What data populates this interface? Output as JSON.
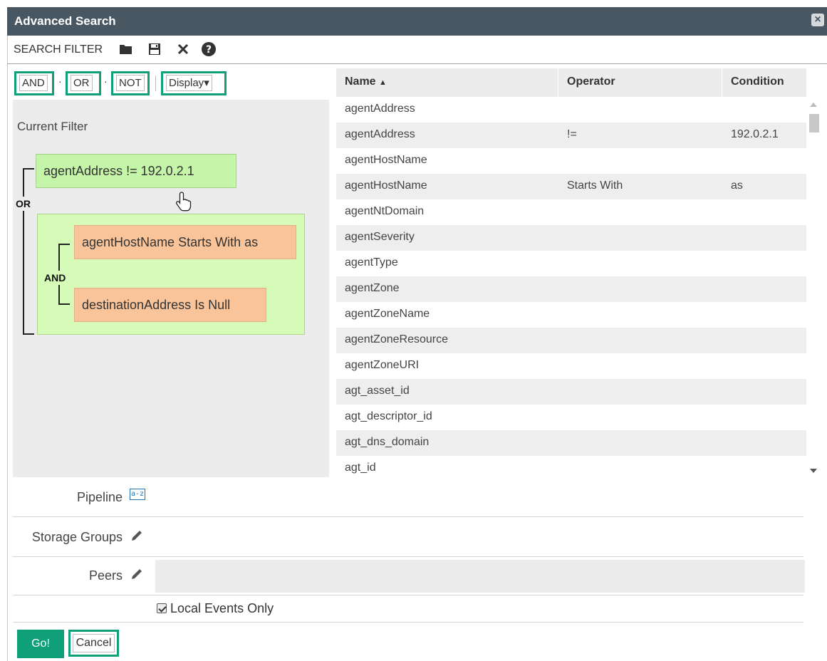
{
  "dialog": {
    "title": "Advanced Search",
    "close_icon": "close-icon"
  },
  "toolbar": {
    "label": "SEARCH FILTER",
    "icons": [
      "folder-open-icon",
      "save-icon",
      "clear-icon",
      "help-icon"
    ]
  },
  "operators": {
    "and": "AND",
    "or": "OR",
    "not": "NOT",
    "separator": "·",
    "display": "Display",
    "display_caret": "▾"
  },
  "filter": {
    "heading": "Current Filter",
    "root_operator": "OR",
    "group_operator": "AND",
    "nodes": {
      "n1": "agentAddress != 192.0.2.1",
      "n2": "agentHostName Starts With as",
      "n3": "destinationAddress Is Null"
    }
  },
  "table": {
    "columns": {
      "name": "Name",
      "operator": "Operator",
      "condition": "Condition"
    },
    "sort_indicator": "▲",
    "rows": [
      {
        "name": "agentAddress",
        "operator": "",
        "condition": ""
      },
      {
        "name": "agentAddress",
        "operator": "!=",
        "condition": "192.0.2.1"
      },
      {
        "name": "agentHostName",
        "operator": "",
        "condition": ""
      },
      {
        "name": "agentHostName",
        "operator": "Starts With",
        "condition": "as"
      },
      {
        "name": "agentNtDomain",
        "operator": "",
        "condition": ""
      },
      {
        "name": "agentSeverity",
        "operator": "",
        "condition": ""
      },
      {
        "name": "agentType",
        "operator": "",
        "condition": ""
      },
      {
        "name": "agentZone",
        "operator": "",
        "condition": ""
      },
      {
        "name": "agentZoneName",
        "operator": "",
        "condition": ""
      },
      {
        "name": "agentZoneResource",
        "operator": "",
        "condition": ""
      },
      {
        "name": "agentZoneURI",
        "operator": "",
        "condition": ""
      },
      {
        "name": "agt_asset_id",
        "operator": "",
        "condition": ""
      },
      {
        "name": "agt_descriptor_id",
        "operator": "",
        "condition": ""
      },
      {
        "name": "agt_dns_domain",
        "operator": "",
        "condition": ""
      },
      {
        "name": "agt_id",
        "operator": "",
        "condition": ""
      }
    ]
  },
  "form": {
    "pipeline_label": "Pipeline",
    "pipeline_icon_text": "a-z",
    "storage_groups_label": "Storage Groups",
    "peers_label": "Peers",
    "peers_value": "",
    "local_events_label": "Local Events Only",
    "local_events_checked": true
  },
  "buttons": {
    "go": "Go!",
    "cancel": "Cancel"
  },
  "colors": {
    "accent": "#0fa07a",
    "titlebar": "#485761",
    "node_green": "#c5f5a8",
    "node_orange": "#f9c499",
    "group_green": "#d6fbb8"
  }
}
